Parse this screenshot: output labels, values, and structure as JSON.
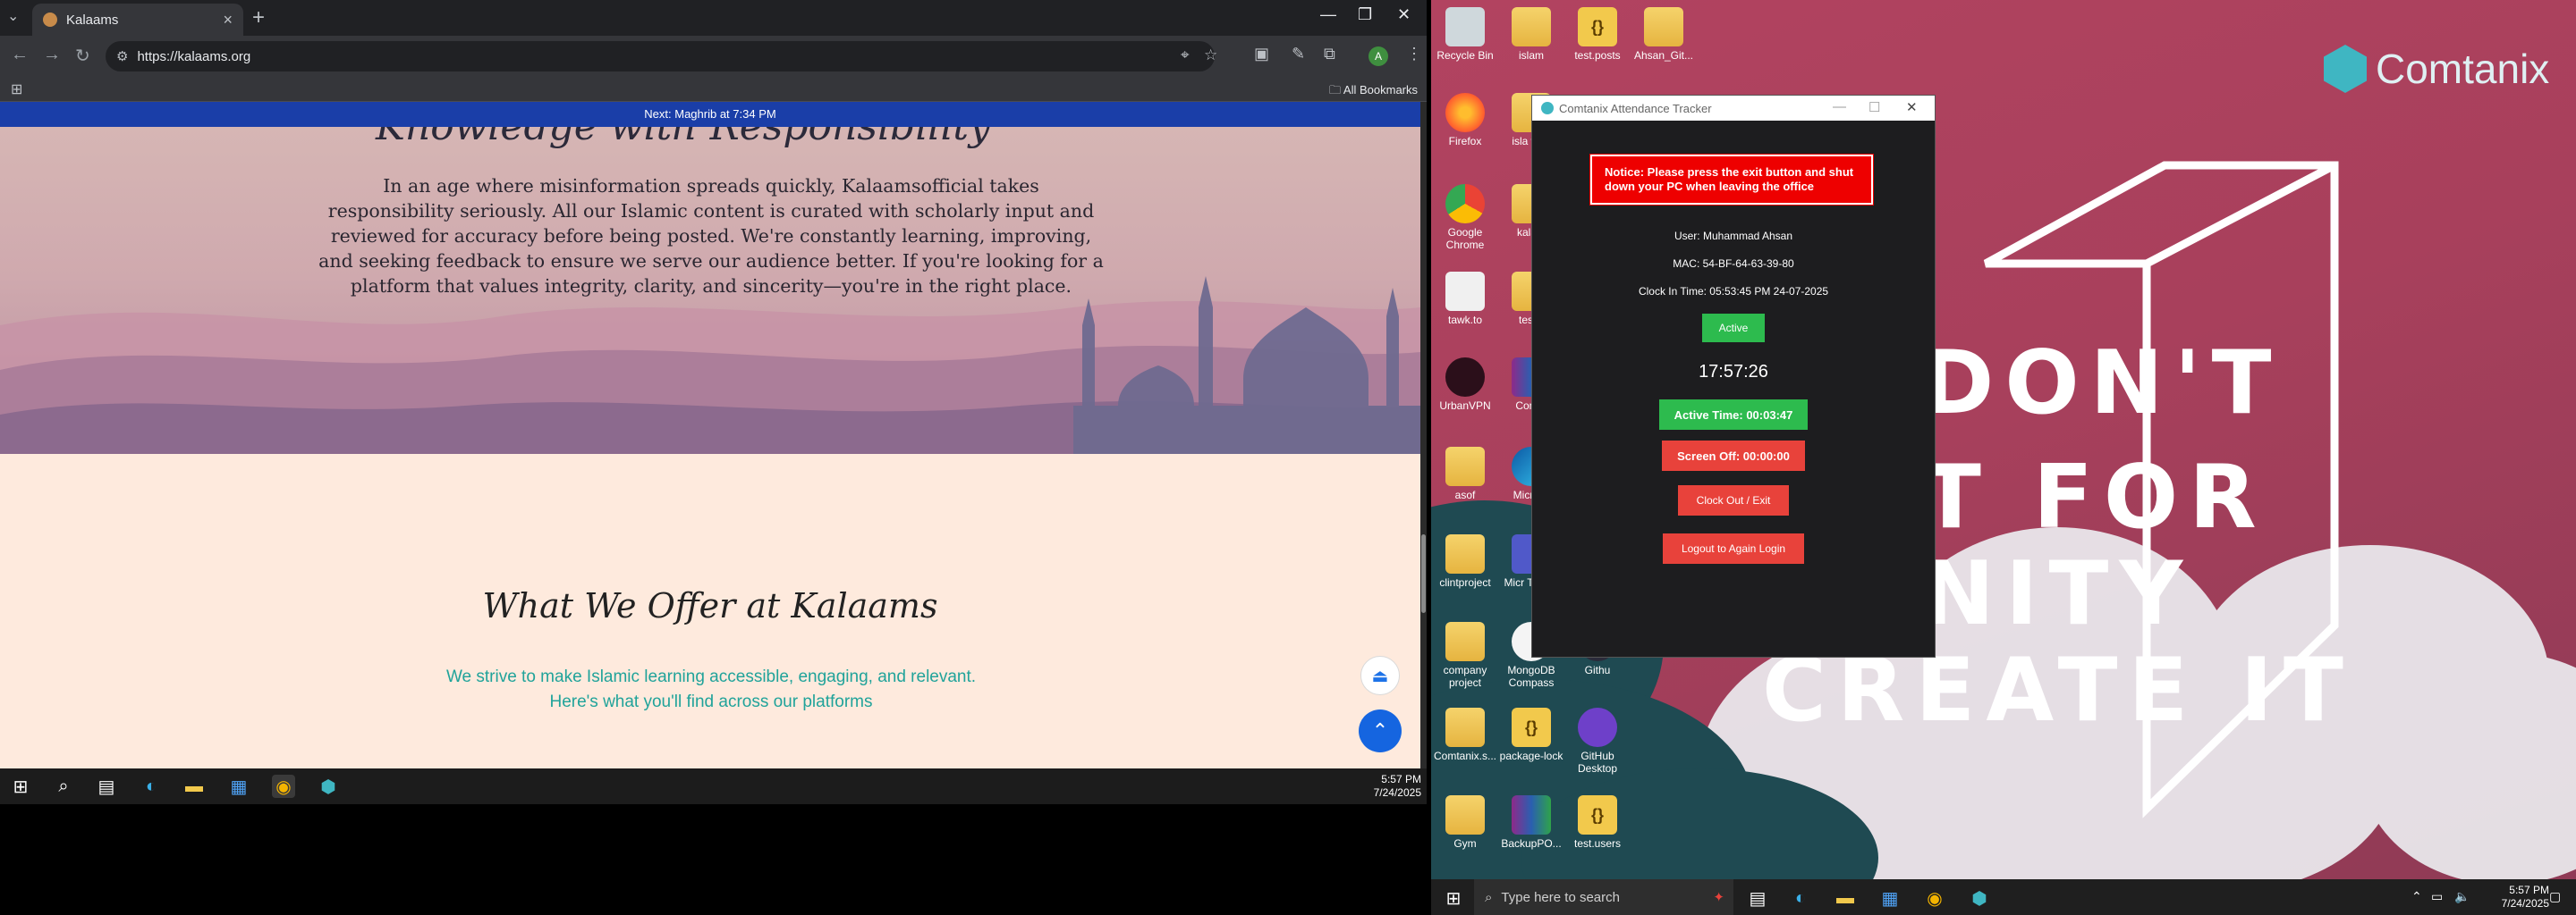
{
  "browser": {
    "tab_title": "Kalaams",
    "new_tab": "+",
    "url": "https://kalaams.org",
    "bookmarks_label": "All Bookmarks",
    "profile_initial": "A"
  },
  "page": {
    "prayer_strip": "Next: Maghrib at 7:34 PM",
    "hero_heading": "Knowledge with Responsibility",
    "hero_paragraph": "In an age where misinformation spreads quickly, Kalaamsofficial takes responsibility seriously. All our Islamic content is curated with scholarly input and reviewed for accuracy before being posted. We're constantly learning, improving, and seeking feedback to ensure we serve our audience better. If you're looking for a platform that values integrity, clarity, and sincerity—you're in the right place.",
    "section_heading": "What We Offer at Kalaams",
    "section_sub_1": "We strive to make Islamic learning accessible, engaging, and relevant.",
    "section_sub_2": "Here's what you'll find across our platforms"
  },
  "left_taskbar": {
    "time": "5:57 PM",
    "date": "7/24/2025"
  },
  "desktop": {
    "brand": "Comtanix",
    "slogan": [
      "DON'T",
      "T FOR",
      "NITY",
      "CREATE IT"
    ],
    "icons": [
      {
        "label": "Recycle Bin",
        "kind": "bin"
      },
      {
        "label": "islam",
        "kind": "folder"
      },
      {
        "label": "test.posts",
        "kind": "json"
      },
      {
        "label": "Ahsan_Git...",
        "kind": "folder"
      },
      {
        "label": "Firefox",
        "kind": "firefox"
      },
      {
        "label": "isla web",
        "kind": "folder"
      },
      {
        "label": "Google Chrome",
        "kind": "chrome"
      },
      {
        "label": "kalam",
        "kind": "folder"
      },
      {
        "label": "tawk.to",
        "kind": "tawk"
      },
      {
        "label": "testw",
        "kind": "folder"
      },
      {
        "label": "UrbanVPN",
        "kind": "vpn"
      },
      {
        "label": "Comta",
        "kind": "rar"
      },
      {
        "label": "asof",
        "kind": "folder"
      },
      {
        "label": "Micr Ed",
        "kind": "edge"
      },
      {
        "label": "clintproject",
        "kind": "folder"
      },
      {
        "label": "Micr Teams",
        "kind": "teams"
      },
      {
        "label": "company project",
        "kind": "folder"
      },
      {
        "label": "MongoDB Compass",
        "kind": "mongo"
      },
      {
        "label": "Githu",
        "kind": "github"
      },
      {
        "label": "Comtanix.s...",
        "kind": "folder"
      },
      {
        "label": "package-lock",
        "kind": "json"
      },
      {
        "label": "GitHub Desktop",
        "kind": "github"
      },
      {
        "label": "Gym",
        "kind": "folder"
      },
      {
        "label": "BackupPO...",
        "kind": "rar"
      },
      {
        "label": "test.users",
        "kind": "json"
      }
    ]
  },
  "tracker": {
    "title": "Comtanix Attendance Tracker",
    "notice": "Notice: Please press the exit button and shut down your PC when leaving the office",
    "user": "User: Muhammad Ahsan",
    "mac": "MAC: 54-BF-64-63-39-80",
    "clock_in": "Clock In Time: 05:53:45 PM 24-07-2025",
    "status": "Active",
    "clock": "17:57:26",
    "active_time": "Active Time: 00:03:47",
    "screen_off": "Screen Off: 00:00:00",
    "clock_out": "Clock Out / Exit",
    "logout": "Logout to Again Login",
    "colors": {
      "green": "#2dbb4e",
      "red": "#e8423b",
      "notice_red": "#ee0000"
    }
  },
  "right_taskbar": {
    "search_placeholder": "Type here to search",
    "time": "5:57 PM",
    "date": "7/24/2025"
  }
}
